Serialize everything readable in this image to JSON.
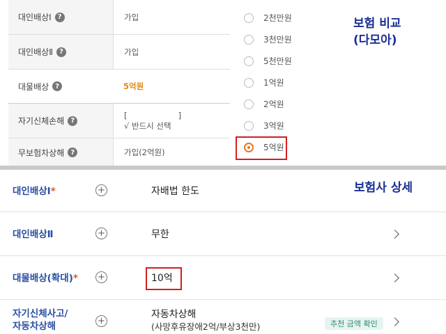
{
  "top": {
    "annotation_line1": "보험 비교",
    "annotation_line2": "(다모아)",
    "rows": [
      {
        "label": "대인배상Ⅰ",
        "value": "가입"
      },
      {
        "label": "대인배상Ⅱ",
        "value": "가입"
      },
      {
        "label": "대물배상",
        "value": "5억원"
      },
      {
        "label": "자기신체손해",
        "value_line1": "[                    ]",
        "value_line2": "√ 반드시 선택"
      },
      {
        "label": "무보험차상해",
        "value": "가입(2억원)"
      }
    ],
    "help_glyph": "?",
    "options": [
      "2천만원",
      "3천만원",
      "5천만원",
      "1억원",
      "2억원",
      "3억원",
      "5억원"
    ],
    "selected_option": "5억원",
    "accent_color": "#ea7520",
    "highlight_color": "#d41e1e"
  },
  "bottom": {
    "annotation": "보험사 상세",
    "rows": [
      {
        "label": "대인배상Ⅰ",
        "required_mark": "*",
        "value": "자배법 한도"
      },
      {
        "label": "대인배상Ⅱ",
        "value": "무한"
      },
      {
        "label": "대물배상(확대)",
        "required_mark": "*",
        "value": "10억"
      },
      {
        "label_line1": "자기신체사고/",
        "label_line2": "자동차상해",
        "value": "자동차상해",
        "value_sub": "(사망후유장애2억/부상3천만)",
        "button": "추천 금액 확인"
      }
    ],
    "plus_glyph": "+",
    "label_color": "#2a4fa5"
  }
}
